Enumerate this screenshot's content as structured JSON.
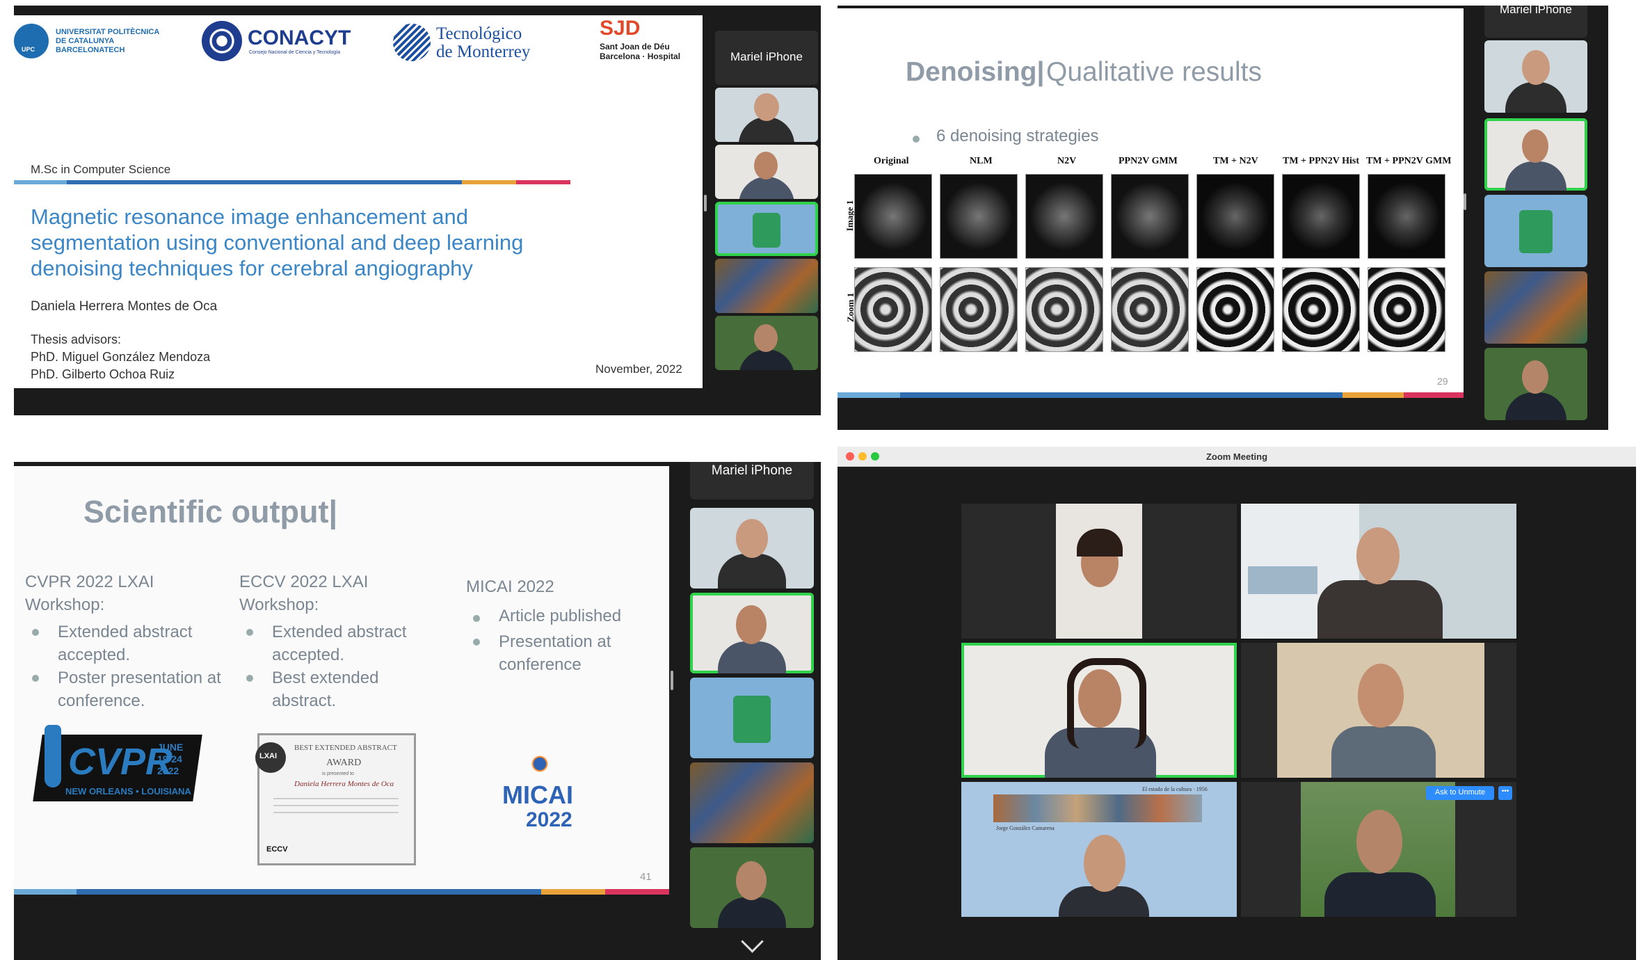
{
  "q1": {
    "logos": {
      "upc": "UNIVERSITAT POLITÈCNICA\nDE CATALUNYA\nBARCELONATECH",
      "upc_short": "UPC",
      "conacyt": "CONACYT",
      "conacyt_sub": "Consejo Nacional de Ciencia y Tecnología",
      "tec": "Tecnológico\nde Monterrey",
      "sjd": "SJD",
      "sjd_sub": "Sant Joan de Déu\nBarcelona · Hospital"
    },
    "degree": "M.Sc in Computer Science",
    "title_lines": [
      "Magnetic resonance image enhancement and",
      "segmentation using conventional and deep learning",
      "denoising techniques for cerebral angiography"
    ],
    "author": "Daniela Herrera Montes de Oca",
    "advisors_label": "Thesis advisors:",
    "advisor1": "PhD. Miguel González Mendoza",
    "advisor2": "PhD. Gilberto Ochoa Ruiz",
    "date": "November, 2022",
    "strip_name": "Mariel iPhone"
  },
  "q2": {
    "title_bold": "Denoising|",
    "title_light": " Qualitative results",
    "bullet": "6 denoising strategies",
    "columns": [
      "Original",
      "NLM",
      "N2V",
      "PPN2V GMM",
      "TM + N2V",
      "TM + PPN2V Hist",
      "TM + PPN2V GMM"
    ],
    "row_labels": [
      "Image 1",
      "Zoom 1"
    ],
    "page": "29",
    "strip_name": "Mariel iPhone"
  },
  "q3": {
    "title": "Scientific output|",
    "col1": {
      "head": "CVPR 2022 LXAI\nWorkshop:",
      "items": [
        "Extended abstract\naccepted.",
        "Poster presentation at\nconference."
      ]
    },
    "col2": {
      "head": "ECCV 2022 LXAI\nWorkshop:",
      "items": [
        "Extended abstract\naccepted.",
        "Best extended\nabstract."
      ]
    },
    "col3": {
      "head": "MICAI 2022",
      "items": [
        "Article published",
        "Presentation at\nconference"
      ]
    },
    "cvpr_logo": {
      "name": "CVPR",
      "date": "JUNE\n19-24\n2022",
      "city": "NEW ORLEANS • LOUISIANA"
    },
    "award": {
      "badge": "LXAI",
      "title": "BEST EXTENDED ABSTRACT",
      "award": "AWARD",
      "to": "is presented to",
      "name": "Daniela Herrera Montes de Oca",
      "footer": "ECCV"
    },
    "micai": {
      "name": "MICAI",
      "year": "2022"
    },
    "page": "41",
    "strip_name": "Mariel iPhone"
  },
  "q4": {
    "window_title": "Zoom Meeting",
    "ask_unmute": "Ask to Unmute",
    "more": "•••",
    "painting_caption": "El estado de la cultura · 1956",
    "painting_author": "Jorge González Camarena"
  }
}
